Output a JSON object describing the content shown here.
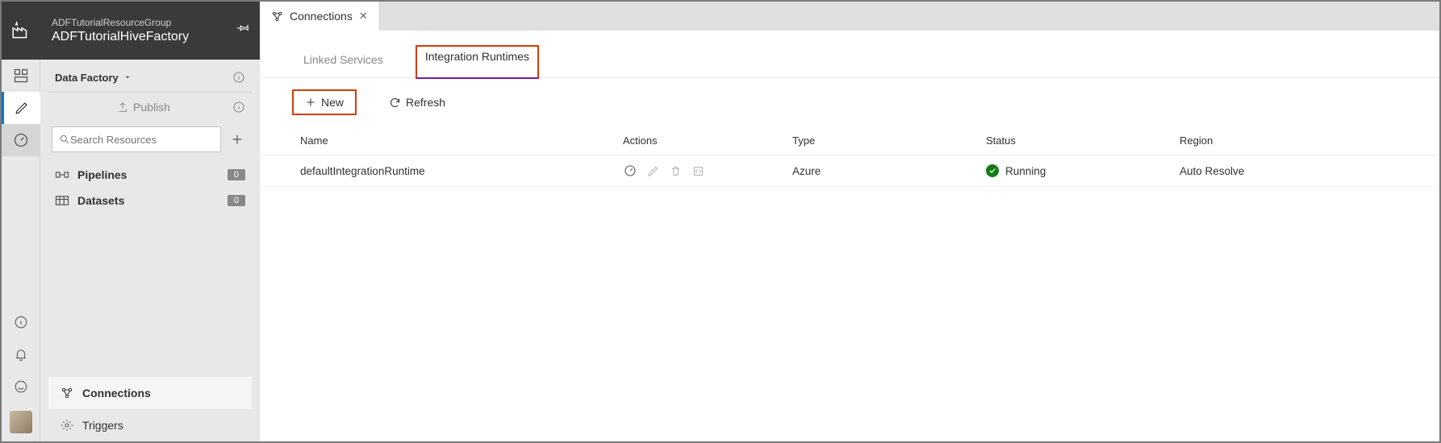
{
  "header": {
    "resource_group": "ADFTutorialResourceGroup",
    "factory_name": "ADFTutorialHiveFactory"
  },
  "sidebar": {
    "breadcrumb_label": "Data Factory",
    "publish_label": "Publish",
    "search_placeholder": "Search Resources",
    "tree": [
      {
        "label": "Pipelines",
        "count": "0"
      },
      {
        "label": "Datasets",
        "count": "0"
      }
    ],
    "bottom": {
      "connections_label": "Connections",
      "triggers_label": "Triggers"
    }
  },
  "tabs": {
    "doc_tab_label": "Connections"
  },
  "sub_tabs": {
    "linked_services": "Linked Services",
    "integration_runtimes": "Integration Runtimes"
  },
  "toolbar": {
    "new_label": "New",
    "refresh_label": "Refresh"
  },
  "grid": {
    "headers": {
      "name": "Name",
      "actions": "Actions",
      "type": "Type",
      "status": "Status",
      "region": "Region"
    },
    "rows": [
      {
        "name": "defaultIntegrationRuntime",
        "type": "Azure",
        "status": "Running",
        "region": "Auto Resolve"
      }
    ]
  }
}
